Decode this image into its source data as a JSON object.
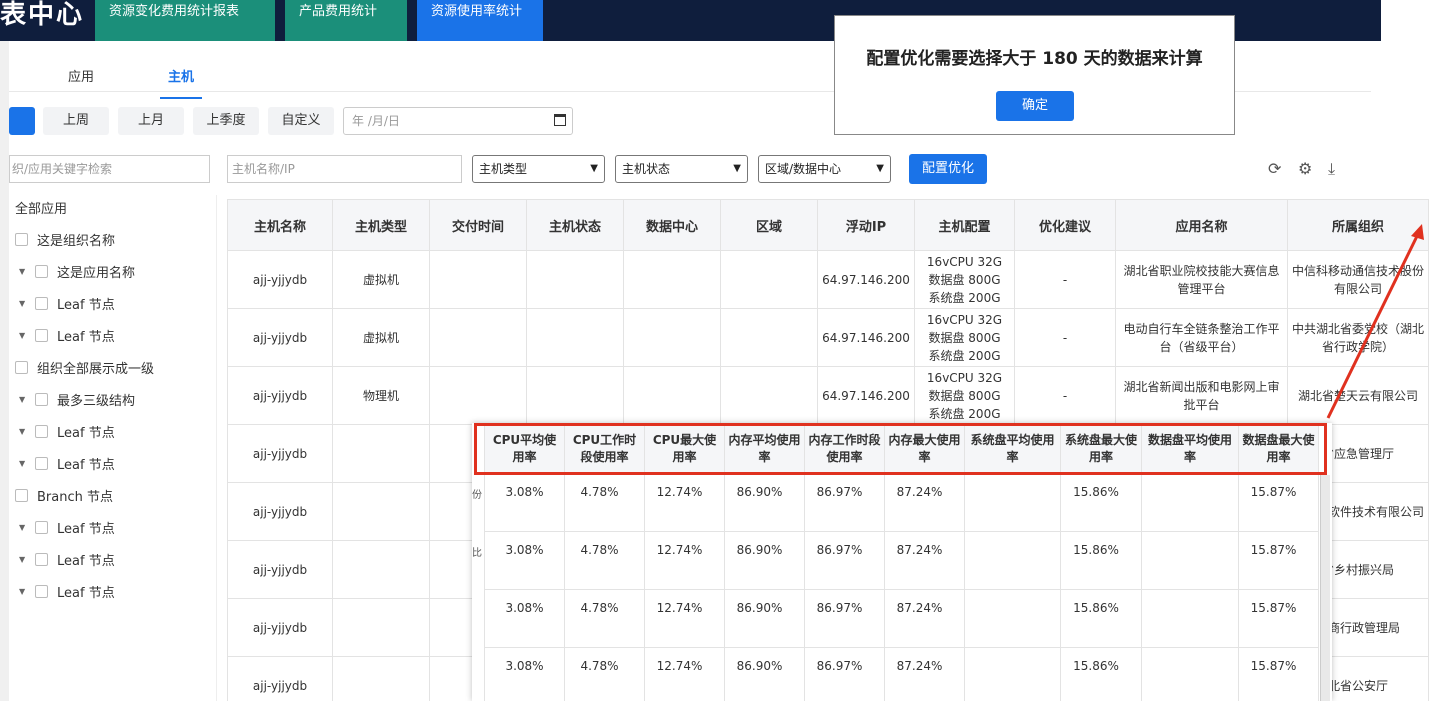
{
  "header": {
    "brand": "表中心",
    "tabs": [
      "资源变化费用统计报表",
      "产品费用统计",
      "资源使用率统计"
    ],
    "active_tab": "资源使用率统计"
  },
  "subtabs": [
    "应用",
    "主机"
  ],
  "active_subtab": "主机",
  "period_buttons": [
    "上周",
    "上月",
    "上季度",
    "自定义"
  ],
  "date_placeholder": "年 /月/日",
  "tree": {
    "search_placeholder": "织/应用关键字检索",
    "nodes": [
      {
        "label": "全部应用",
        "level": 0,
        "checkbox": false,
        "arrow": false
      },
      {
        "label": "这是组织名称",
        "level": 0,
        "checkbox": true,
        "arrow": false
      },
      {
        "label": "这是应用名称",
        "level": 1,
        "checkbox": true,
        "arrow": true
      },
      {
        "label": "Leaf 节点",
        "level": 1,
        "checkbox": true,
        "arrow": true
      },
      {
        "label": "Leaf 节点",
        "level": 1,
        "checkbox": true,
        "arrow": true
      },
      {
        "label": "组织全部展示成一级",
        "level": 0,
        "checkbox": true,
        "arrow": false
      },
      {
        "label": "最多三级结构",
        "level": 1,
        "checkbox": true,
        "arrow": true
      },
      {
        "label": "Leaf 节点",
        "level": 1,
        "checkbox": true,
        "arrow": true
      },
      {
        "label": "Leaf 节点",
        "level": 1,
        "checkbox": true,
        "arrow": true
      },
      {
        "label": "Branch 节点",
        "level": 0,
        "checkbox": true,
        "arrow": false
      },
      {
        "label": "Leaf 节点",
        "level": 1,
        "checkbox": true,
        "arrow": true
      },
      {
        "label": "Leaf 节点",
        "level": 1,
        "checkbox": true,
        "arrow": true
      },
      {
        "label": "Leaf 节点",
        "level": 1,
        "checkbox": true,
        "arrow": true
      }
    ]
  },
  "filters": {
    "host_search_placeholder": "主机名称/IP",
    "selects": [
      "主机类型",
      "主机状态",
      "区域/数据中心"
    ],
    "optimize_button": "配置优化"
  },
  "table": {
    "columns": [
      "主机名称",
      "主机类型",
      "交付时间",
      "主机状态",
      "数据中心",
      "区域",
      "浮动IP",
      "主机配置",
      "优化建议",
      "应用名称",
      "所属组织"
    ],
    "rows": [
      [
        "ajj-yjjydb",
        "虚拟机",
        "",
        "",
        "",
        "",
        "64.97.146.200",
        [
          "16vCPU 32G",
          "数据盘 800G",
          "系统盘 200G"
        ],
        "-",
        "湖北省职业院校技能大赛信息管理平台",
        "中信科移动通信技术股份有限公司"
      ],
      [
        "ajj-yjjydb",
        "虚拟机",
        "",
        "",
        "",
        "",
        "64.97.146.200",
        [
          "16vCPU 32G",
          "数据盘 800G",
          "系统盘 200G"
        ],
        "-",
        "电动自行车全链条整治工作平台（省级平台）",
        "中共湖北省委党校（湖北省行政学院）"
      ],
      [
        "ajj-yjjydb",
        "物理机",
        "",
        "",
        "",
        "",
        "64.97.146.200",
        [
          "16vCPU 32G",
          "数据盘 800G",
          "系统盘 200G"
        ],
        "-",
        "湖北省新闻出版和电影网上审批平台",
        "湖北省楚天云有限公司"
      ],
      [
        "ajj-yjjydb",
        "",
        "",
        "",
        "",
        "",
        "",
        [],
        "",
        "",
        "省应急管理厅"
      ],
      [
        "ajj-yjjydb",
        "",
        "",
        "",
        "",
        "",
        "",
        [],
        "",
        "",
        "火云创软件技术有限公司"
      ],
      [
        "ajj-yjjydb",
        "",
        "",
        "",
        "",
        "",
        "",
        [],
        "",
        "",
        "省乡村振兴局"
      ],
      [
        "ajj-yjjydb",
        "",
        "",
        "",
        "",
        "",
        "",
        [],
        "",
        "",
        "工商行政管理局"
      ],
      [
        "ajj-yjjydb",
        "",
        "",
        "",
        "",
        "",
        "",
        [],
        "",
        "",
        "北省公安厅"
      ]
    ]
  },
  "dialog": {
    "message": "配置优化需要选择大于 180 天的数据来计算",
    "ok_label": "确定"
  },
  "usage_panel": {
    "columns": [
      "CPU平均使用率",
      "CPU工作时段使用率",
      "CPU最大使用率",
      "内存平均使用率",
      "内存工作时段使用率",
      "内存最大使用率",
      "系统盘平均使用率",
      "系统盘最大使用率",
      "数据盘平均使用率",
      "数据盘最大使用率"
    ],
    "rows": [
      [
        "3.08%",
        "4.78%",
        "12.74%",
        "86.90%",
        "86.97%",
        "87.24%",
        "",
        "15.86%",
        "",
        "15.87%"
      ],
      [
        "3.08%",
        "4.78%",
        "12.74%",
        "86.90%",
        "86.97%",
        "87.24%",
        "",
        "15.86%",
        "",
        "15.87%"
      ],
      [
        "3.08%",
        "4.78%",
        "12.74%",
        "86.90%",
        "86.97%",
        "87.24%",
        "",
        "15.86%",
        "",
        "15.87%"
      ],
      [
        "3.08%",
        "4.78%",
        "12.74%",
        "86.90%",
        "86.97%",
        "87.24%",
        "",
        "15.86%",
        "",
        "15.87%"
      ]
    ],
    "peek_chars": [
      "份",
      "比"
    ]
  },
  "colors": {
    "topbar": "#0f1e3d",
    "tab_green": "#1b8f7a",
    "accent_blue": "#1a73e8",
    "highlight_red": "#e0311f"
  }
}
